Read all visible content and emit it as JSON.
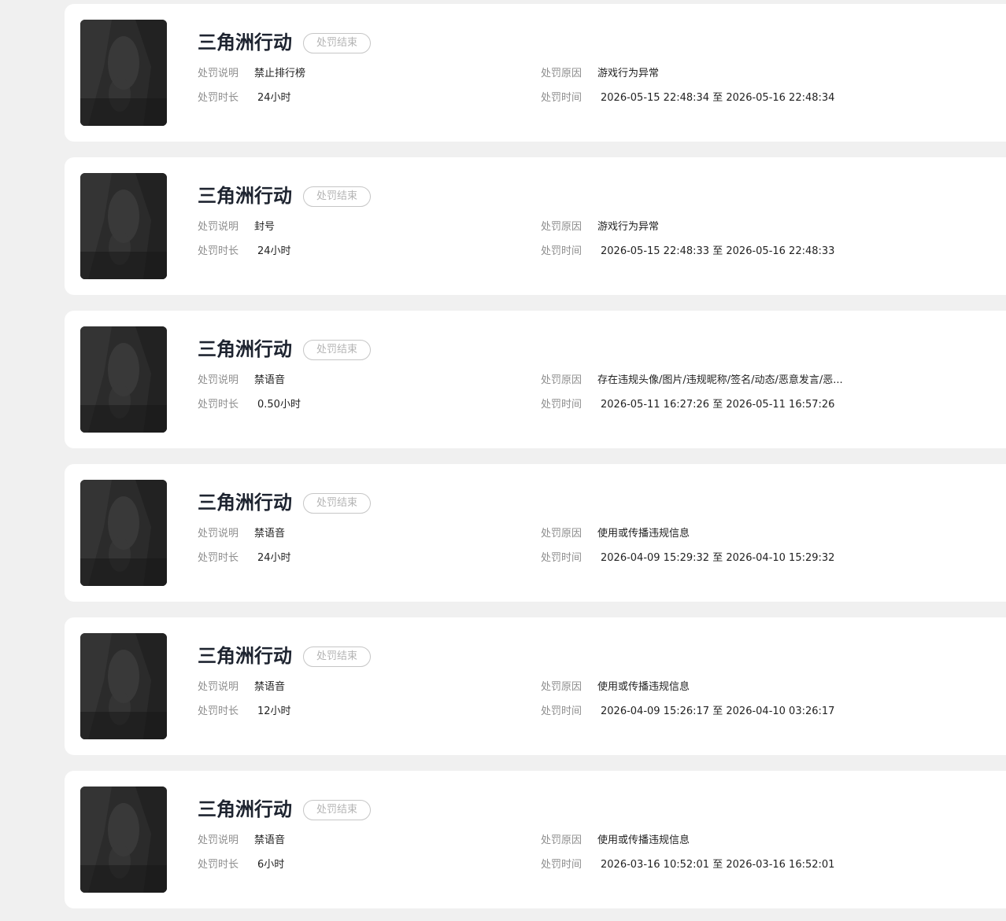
{
  "labels": {
    "desc": "处罚说明",
    "duration": "处罚时长",
    "reason": "处罚原因",
    "time": "处罚时间",
    "range_sep": "至"
  },
  "records": [
    {
      "game": "三角洲行动",
      "status": "处罚结束",
      "desc": "禁止排行榜",
      "duration": "24小时",
      "reason": "游戏行为异常",
      "start": "2026-05-15 22:48:34",
      "end": "2026-05-16 22:48:34"
    },
    {
      "game": "三角洲行动",
      "status": "处罚结束",
      "desc": "封号",
      "duration": "24小时",
      "reason": "游戏行为异常",
      "start": "2026-05-15 22:48:33",
      "end": "2026-05-16 22:48:33"
    },
    {
      "game": "三角洲行动",
      "status": "处罚结束",
      "desc": "禁语音",
      "duration": "0.50小时",
      "reason": "存在违规头像/图片/违规昵称/签名/动态/恶意发言/恶...",
      "start": "2026-05-11 16:27:26",
      "end": "2026-05-11 16:57:26"
    },
    {
      "game": "三角洲行动",
      "status": "处罚结束",
      "desc": "禁语音",
      "duration": "24小时",
      "reason": "使用或传播违规信息",
      "start": "2026-04-09 15:29:32",
      "end": "2026-04-10 15:29:32"
    },
    {
      "game": "三角洲行动",
      "status": "处罚结束",
      "desc": "禁语音",
      "duration": "12小时",
      "reason": "使用或传播违规信息",
      "start": "2026-04-09 15:26:17",
      "end": "2026-04-10 03:26:17"
    },
    {
      "game": "三角洲行动",
      "status": "处罚结束",
      "desc": "禁语音",
      "duration": "6小时",
      "reason": "使用或传播违规信息",
      "start": "2026-03-16 10:52:01",
      "end": "2026-03-16 16:52:01"
    }
  ]
}
